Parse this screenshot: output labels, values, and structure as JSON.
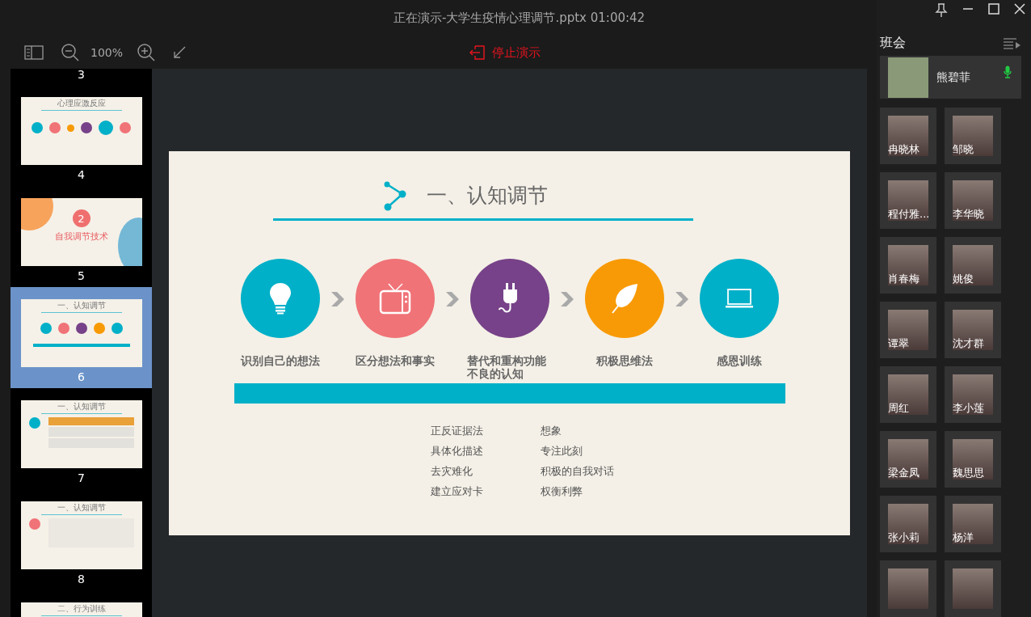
{
  "window": {
    "title": "正在演示-大学生疫情心理调节.pptx 01:00:42"
  },
  "toolbar": {
    "zoom": "100%",
    "stop_button": "停止演示"
  },
  "thumbnails": [
    {
      "number": "3",
      "selected": false
    },
    {
      "number": "4",
      "kind": "timeline",
      "title": "心理应激反应",
      "selected": false
    },
    {
      "number": "5",
      "kind": "section",
      "title": "自我调节技术",
      "badge": "2",
      "selected": false
    },
    {
      "number": "6",
      "kind": "process",
      "title": "一、认知调节",
      "selected": true
    },
    {
      "number": "7",
      "kind": "table",
      "title": "一、认知调节",
      "selected": false
    },
    {
      "number": "8",
      "kind": "list",
      "title": "一、认知调节",
      "selected": false
    },
    {
      "kind": "partial",
      "title": "二、行为训练",
      "selected": false
    }
  ],
  "slide": {
    "title": "一、认知调节",
    "steps": [
      {
        "label": "识别自己的想法",
        "color": "#00b0c8"
      },
      {
        "label": "区分想法和事实",
        "color": "#f07377"
      },
      {
        "label": "替代和重构功能不良的认知",
        "color": "#774289"
      },
      {
        "label": "积极思维法",
        "color": "#f89a05"
      },
      {
        "label": "感恩训练",
        "color": "#00b0c8"
      }
    ],
    "methods_left": [
      "正反证据法",
      "具体化描述",
      "去灾难化",
      "建立应对卡"
    ],
    "methods_right": [
      "想象",
      "专注此刻",
      "积极的自我对话",
      "权衡利弊"
    ]
  },
  "panel": {
    "title": "班会",
    "host": {
      "name": "熊碧菲",
      "mic_on": true
    },
    "participants": [
      {
        "name": "冉晓林"
      },
      {
        "name": "邹晓"
      },
      {
        "name": "程付雅..."
      },
      {
        "name": "李华晓"
      },
      {
        "name": "肖春梅"
      },
      {
        "name": "姚俊"
      },
      {
        "name": "谭翠"
      },
      {
        "name": "沈才群"
      },
      {
        "name": "周红"
      },
      {
        "name": "李小莲"
      },
      {
        "name": "梁金凤"
      },
      {
        "name": "魏思思"
      },
      {
        "name": "张小莉"
      },
      {
        "name": "杨洋"
      },
      {
        "kind": "cut_off"
      },
      {
        "kind": "cut_off"
      }
    ]
  }
}
